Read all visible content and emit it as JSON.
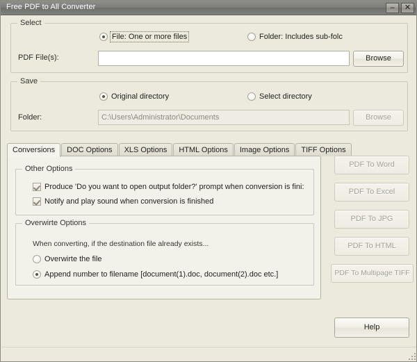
{
  "window": {
    "title": "Free PDF to All Converter",
    "minimize_label": "–",
    "close_label": "✕"
  },
  "select_group": {
    "legend": "Select",
    "radio_file_label": "File:  One or more files",
    "radio_folder_label": "Folder: Includes sub-folc",
    "radio_selected": "file",
    "pdf_files_label": "PDF File(s):",
    "pdf_files_value": "",
    "pdf_files_placeholder": "",
    "browse_label": "Browse"
  },
  "save_group": {
    "legend": "Save",
    "radio_original_label": "Original directory",
    "radio_select_label": "Select directory",
    "radio_selected": "original",
    "folder_label": "Folder:",
    "folder_value": "C:\\Users\\Administrator\\Documents",
    "browse_label": "Browse"
  },
  "tabs": [
    {
      "label": "Conversions",
      "active": true
    },
    {
      "label": "DOC Options",
      "active": false
    },
    {
      "label": "XLS Options",
      "active": false
    },
    {
      "label": "HTML Options",
      "active": false
    },
    {
      "label": "Image Options",
      "active": false
    },
    {
      "label": "TIFF Options",
      "active": false
    }
  ],
  "other_options": {
    "legend": "Other Options",
    "checkbox_prompt_label": "Produce 'Do you want to open output folder?' prompt when conversion is fini:",
    "checkbox_prompt_checked": true,
    "checkbox_notify_label": "Notify and play sound when conversion is finished",
    "checkbox_notify_checked": true
  },
  "overwrite_options": {
    "legend": "Overwirte Options",
    "description": "When converting, if the destination file already exists...",
    "radio_overwrite_label": "Overwirte the file",
    "radio_append_label": "Append number to filename   [document(1).doc, document(2).doc etc.]",
    "radio_selected": "append"
  },
  "actions": [
    {
      "label": "PDF To Word",
      "disabled": true
    },
    {
      "label": "PDF To Excel",
      "disabled": true
    },
    {
      "label": "PDF To JPG",
      "disabled": true
    },
    {
      "label": "PDF To HTML",
      "disabled": true
    },
    {
      "label": "PDF To Multipage TIFF",
      "disabled": true
    }
  ],
  "help_button": {
    "label": "Help"
  },
  "colors": {
    "window_background": "#ece9dd",
    "titlebar": "#7e7e7a",
    "panel_background": "#f2f1ea",
    "text": "#22221f",
    "disabled_text": "#a3a197"
  }
}
